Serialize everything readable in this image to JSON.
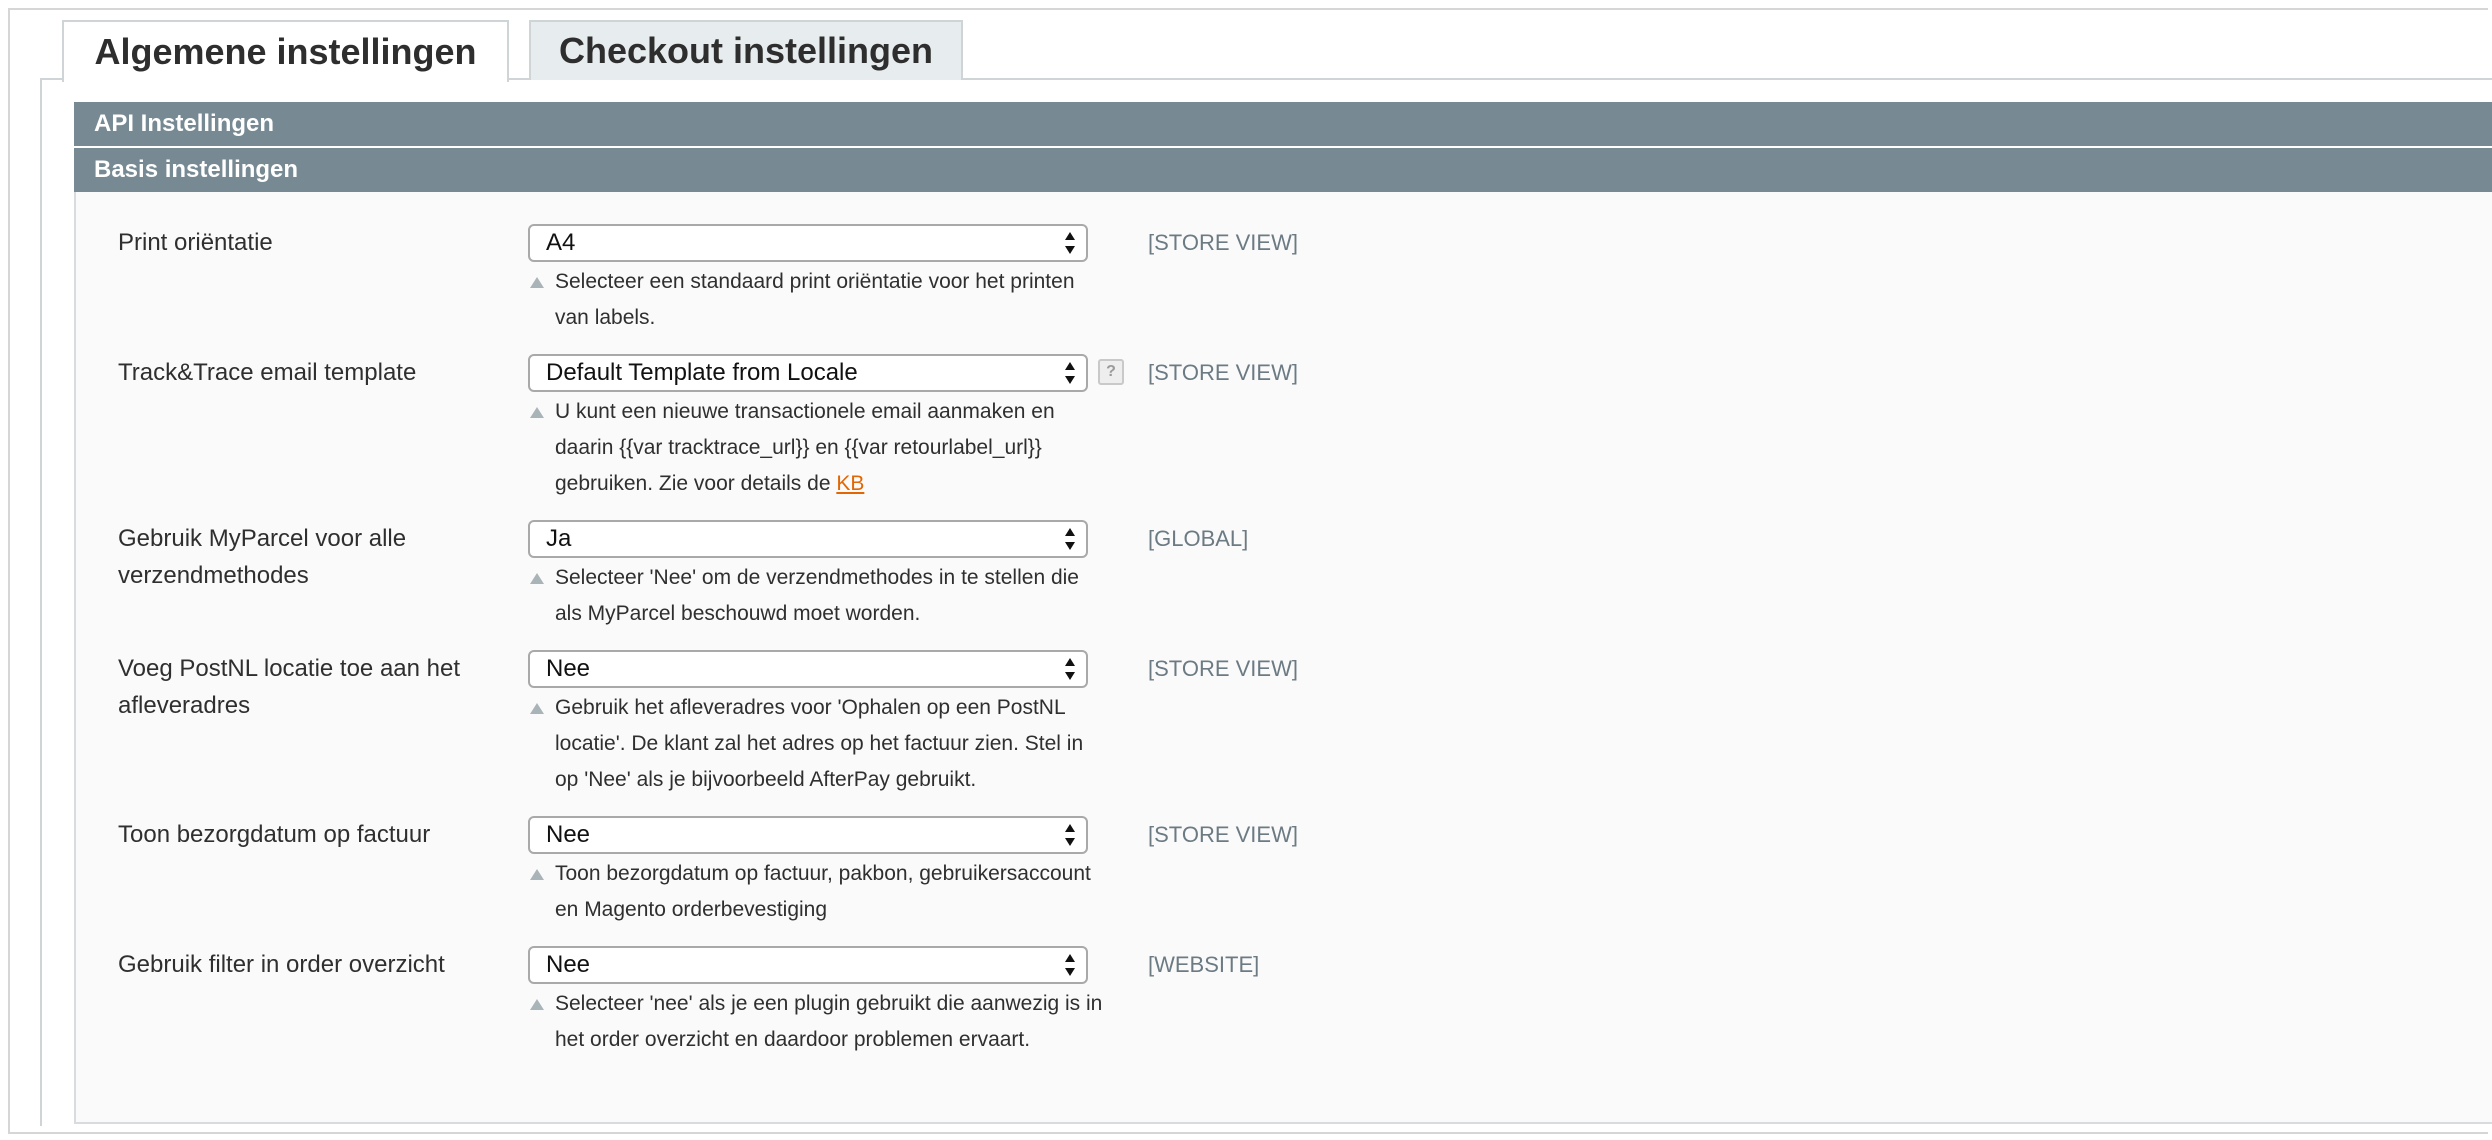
{
  "tabs": {
    "general": "Algemene instellingen",
    "checkout": "Checkout instellingen"
  },
  "sections": {
    "api": "API Instellingen",
    "basis": "Basis instellingen"
  },
  "rows": [
    {
      "label": "Print oriëntatie",
      "value": "A4",
      "scope": "[STORE VIEW]",
      "note": "Selecteer een standaard print oriëntatie voor het printen van labels."
    },
    {
      "label": "Track&Trace email template",
      "value": "Default Template from Locale",
      "scope": "[STORE VIEW]",
      "note_pre": "U kunt een nieuwe transactionele email aanmaken en daarin {{var tracktrace_url}} en {{var retourlabel_url}} gebruiken. Zie voor details de ",
      "note_link": "KB",
      "help": "?"
    },
    {
      "label": "Gebruik MyParcel voor alle verzendmethodes",
      "value": "Ja",
      "scope": "[GLOBAL]",
      "note": "Selecteer 'Nee' om de verzendmethodes in te stellen die als MyParcel beschouwd moet worden."
    },
    {
      "label": "Voeg PostNL locatie toe aan het afleveradres",
      "value": "Nee",
      "scope": "[STORE VIEW]",
      "note": "Gebruik het afleveradres voor 'Ophalen op een PostNL locatie'. De klant zal het adres op het factuur zien. Stel in op 'Nee' als je bijvoorbeeld AfterPay gebruikt."
    },
    {
      "label": "Toon bezorgdatum op factuur",
      "value": "Nee",
      "scope": "[STORE VIEW]",
      "note": "Toon bezorgdatum op factuur, pakbon, gebruikersaccount en Magento orderbevestiging"
    },
    {
      "label": "Gebruik filter in order overzicht",
      "value": "Nee",
      "scope": "[WEBSITE]",
      "note": "Selecteer 'nee' als je een plugin gebruikt die aanwezig is in het order overzicht en daardoor problemen ervaart."
    }
  ],
  "icons": {
    "select_arrows": "up-down-arrows-icon",
    "note_marker": "triangle-up-icon",
    "help": "question-mark-icon"
  },
  "colors": {
    "section_bar": "#778a93",
    "scope_text": "#6c7b83",
    "link": "#e26703",
    "inactive_tab": "#e7ecee"
  }
}
